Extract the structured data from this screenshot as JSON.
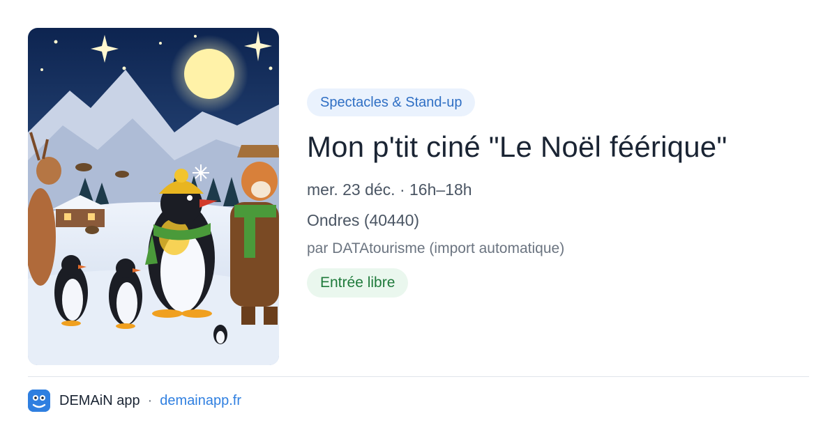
{
  "event": {
    "image_alt": "Illustration: penguins, a deer and a fox in a snowy mountain night scene",
    "category": "Spectacles & Stand-up",
    "title": "Mon p'tit ciné \"Le Noël féérique\"",
    "datetime": "mer. 23 déc. · 16h–18h",
    "location": "Ondres (40440)",
    "organizer": "par DATAtourisme (import automatique)",
    "price": "Entrée libre"
  },
  "footer": {
    "logo_icon": "demain-app-logo-icon",
    "app_name": "DEMAiN app",
    "separator": "·",
    "domain": "demainapp.fr"
  },
  "colors": {
    "accent": "#2f7fe0",
    "category_bg": "#eaf2fd",
    "category_text": "#2f6fc4",
    "price_bg": "#eaf7ee",
    "price_text": "#1f7a3b",
    "title_text": "#1a2433"
  }
}
